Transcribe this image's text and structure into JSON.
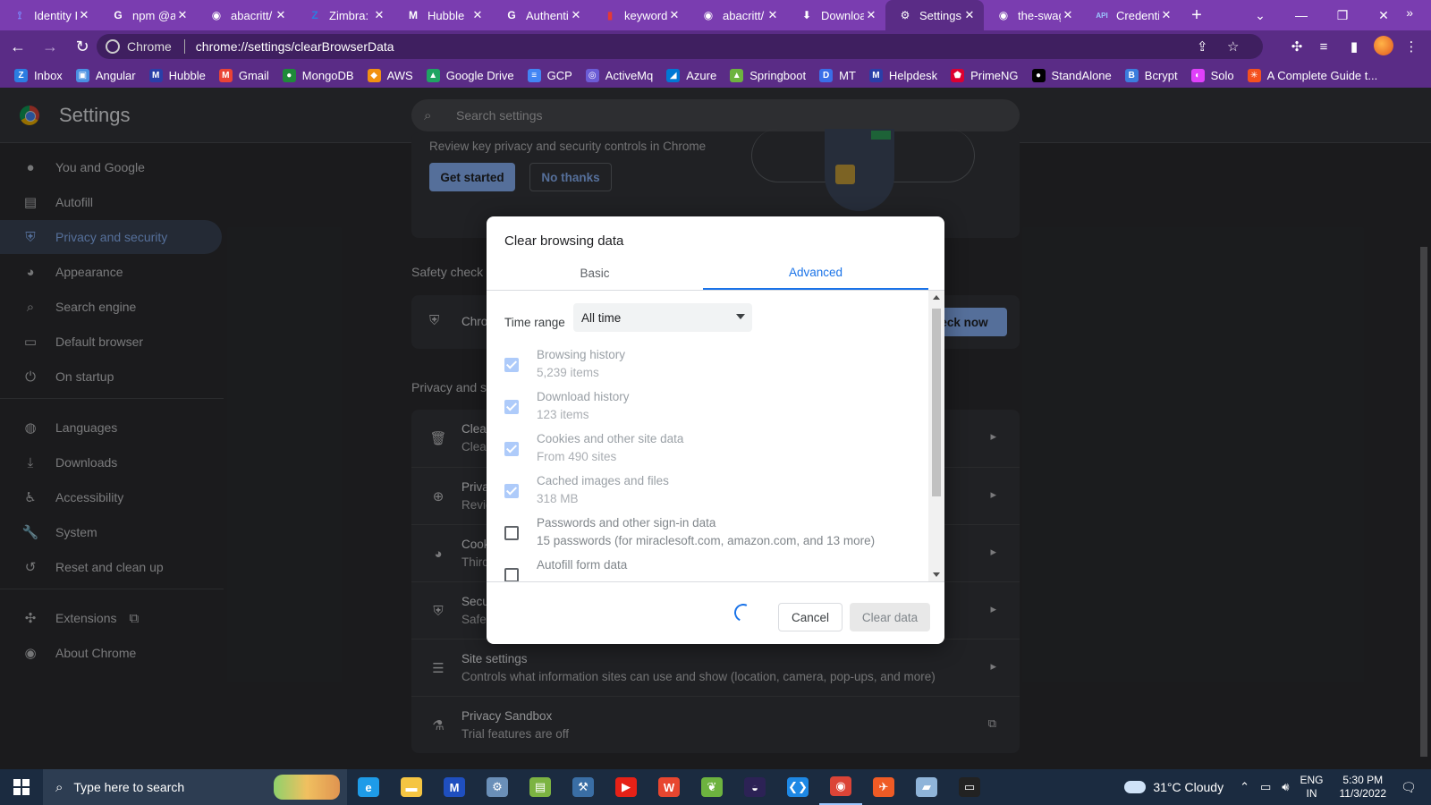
{
  "tabs": [
    {
      "label": "Identity I",
      "icon": "identity-icon",
      "color": "#7b8cff"
    },
    {
      "label": "npm @a",
      "icon": "google-icon",
      "color": "#ffffff"
    },
    {
      "label": "abacritt/",
      "icon": "github-icon",
      "color": "#ffffff"
    },
    {
      "label": "Zimbra: I",
      "icon": "zimbra-icon",
      "color": "#2b7de1"
    },
    {
      "label": "Hubble",
      "icon": "hubble-icon",
      "color": "#ffffff"
    },
    {
      "label": "Authenti",
      "icon": "google-icon",
      "color": "#ffffff"
    },
    {
      "label": "keyword",
      "icon": "keyword-icon",
      "color": "#e53935"
    },
    {
      "label": "abacritt/",
      "icon": "github-icon",
      "color": "#ffffff"
    },
    {
      "label": "Downloa",
      "icon": "download-icon",
      "color": "#ffffff"
    },
    {
      "label": "Settings",
      "icon": "gear-icon",
      "color": "#ffffff",
      "active": true
    },
    {
      "label": "the-swag",
      "icon": "github-icon",
      "color": "#ffffff"
    },
    {
      "label": "Credenti",
      "icon": "api-icon",
      "color": "#9cc7ff"
    }
  ],
  "tab_icon_glyphs": {
    "identity-icon": "⟟",
    "google-icon": "G",
    "github-icon": "◉",
    "zimbra-icon": "Z",
    "hubble-icon": "M",
    "keyword-icon": "▮",
    "download-icon": "⬇",
    "gear-icon": "⚙",
    "api-icon": "API"
  },
  "omnibox": {
    "chip": "Chrome",
    "url": "chrome://settings/clearBrowserData"
  },
  "bookmarks": [
    {
      "label": "Inbox",
      "glyph": "Z",
      "color": "#2b7de1"
    },
    {
      "label": "Angular",
      "glyph": "▣",
      "color": "#4a90e2"
    },
    {
      "label": "Hubble",
      "glyph": "M",
      "color": "#2a3fa8"
    },
    {
      "label": "Gmail",
      "glyph": "M",
      "color": "#ea4335"
    },
    {
      "label": "MongoDB",
      "glyph": "●",
      "color": "#1f8a3a"
    },
    {
      "label": "AWS",
      "glyph": "◆",
      "color": "#f29111"
    },
    {
      "label": "Google Drive",
      "glyph": "▲",
      "color": "#1fa463"
    },
    {
      "label": "GCP",
      "glyph": "≡",
      "color": "#4285f4"
    },
    {
      "label": "ActiveMq",
      "glyph": "◎",
      "color": "#6b5cd6"
    },
    {
      "label": "Azure",
      "glyph": "◢",
      "color": "#0078d4"
    },
    {
      "label": "Springboot",
      "glyph": "▲",
      "color": "#6db33f"
    },
    {
      "label": "MT",
      "glyph": "D",
      "color": "#3a6ee8"
    },
    {
      "label": "Helpdesk",
      "glyph": "M",
      "color": "#2a3fa8"
    },
    {
      "label": "PrimeNG",
      "glyph": "⬟",
      "color": "#dd0031"
    },
    {
      "label": "StandAlone",
      "glyph": "●",
      "color": "#000000"
    },
    {
      "label": "Bcrypt",
      "glyph": "B",
      "color": "#3b7ddd"
    },
    {
      "label": "Solo",
      "glyph": "◐",
      "color": "#e040fb"
    },
    {
      "label": "A Complete Guide t...",
      "glyph": "✳",
      "color": "#f4511e"
    }
  ],
  "settings": {
    "title": "Settings",
    "search_placeholder": "Search settings"
  },
  "nav": [
    {
      "label": "You and Google",
      "icon": "person-icon",
      "glyph": "●"
    },
    {
      "label": "Autofill",
      "icon": "clipboard-icon",
      "glyph": "▤"
    },
    {
      "label": "Privacy and security",
      "icon": "shield-icon",
      "glyph": "⛨",
      "active": true
    },
    {
      "label": "Appearance",
      "icon": "palette-icon",
      "glyph": "◕"
    },
    {
      "label": "Search engine",
      "icon": "search-icon",
      "glyph": "⌕"
    },
    {
      "label": "Default browser",
      "icon": "browser-icon",
      "glyph": "▭"
    },
    {
      "label": "On startup",
      "icon": "power-icon",
      "glyph": "⏻"
    },
    {
      "label": "Languages",
      "icon": "globe-icon",
      "glyph": "◍"
    },
    {
      "label": "Downloads",
      "icon": "download-icon",
      "glyph": "⤓"
    },
    {
      "label": "Accessibility",
      "icon": "accessibility-icon",
      "glyph": "♿"
    },
    {
      "label": "System",
      "icon": "wrench-icon",
      "glyph": "🔧"
    },
    {
      "label": "Reset and clean up",
      "icon": "history-icon",
      "glyph": "↺"
    },
    {
      "label": "Extensions",
      "icon": "puzzle-icon",
      "glyph": "✣"
    },
    {
      "label": "About Chrome",
      "icon": "chrome-icon",
      "glyph": "◉"
    }
  ],
  "main": {
    "guide_text": "Review key privacy and security controls in Chrome",
    "get_started": "Get started",
    "no_thanks": "No thanks",
    "safety_check_title": "Safety check",
    "safety_row_title": "Chro",
    "check_now": "eck now",
    "privacy_section_title": "Privacy and s",
    "rows": [
      {
        "title": "Clear",
        "sub": "Clear",
        "icon": "trash-icon",
        "glyph": "🗑"
      },
      {
        "title": "Priva",
        "sub": "Revie",
        "icon": "privacy-guide-icon",
        "glyph": "⊕"
      },
      {
        "title": "Cook",
        "sub": "Third",
        "icon": "cookie-icon",
        "glyph": "◕"
      },
      {
        "title": "Secu",
        "sub": "Safe",
        "icon": "shield-icon",
        "glyph": "⛨"
      },
      {
        "title": "Site settings",
        "sub": "Controls what information sites can use and show (location, camera, pop-ups, and more)",
        "icon": "sliders-icon",
        "glyph": "☰"
      },
      {
        "title": "Privacy Sandbox",
        "sub": "Trial features are off",
        "icon": "flask-icon",
        "glyph": "⚗",
        "external": true
      }
    ]
  },
  "dialog": {
    "title": "Clear browsing data",
    "tab_basic": "Basic",
    "tab_advanced": "Advanced",
    "time_range_label": "Time range",
    "time_range_value": "All time",
    "options": [
      {
        "title": "Browsing history",
        "sub": "5,239 items",
        "checked": true
      },
      {
        "title": "Download history",
        "sub": "123 items",
        "checked": true
      },
      {
        "title": "Cookies and other site data",
        "sub": "From 490 sites",
        "checked": true
      },
      {
        "title": "Cached images and files",
        "sub": "318 MB",
        "checked": true
      },
      {
        "title": "Passwords and other sign-in data",
        "sub": "15 passwords (for miraclesoft.com, amazon.com, and 13 more)",
        "checked": false
      },
      {
        "title": "Autofill form data",
        "sub": "",
        "checked": false
      }
    ],
    "cancel": "Cancel",
    "clear": "Clear data"
  },
  "taskbar": {
    "search_placeholder": "Type here to search",
    "weather": "31°C  Cloudy",
    "lang_line1": "ENG",
    "lang_line2": "IN",
    "time": "5:30 PM",
    "date": "11/3/2022",
    "apps": [
      {
        "name": "edge-icon",
        "glyph": "e",
        "color": "#1e9be8"
      },
      {
        "name": "file-explorer-icon",
        "glyph": "▬",
        "color": "#f5c542"
      },
      {
        "name": "hubble-app-icon",
        "glyph": "M",
        "color": "#1f4fbf"
      },
      {
        "name": "network-icon",
        "glyph": "⚙",
        "color": "#6a8fb8"
      },
      {
        "name": "notepad-icon",
        "glyph": "▤",
        "color": "#7cb342"
      },
      {
        "name": "ssms-icon",
        "glyph": "⚒",
        "color": "#3a6ea5"
      },
      {
        "name": "youtube-icon",
        "glyph": "▶",
        "color": "#e62117"
      },
      {
        "name": "wps-icon",
        "glyph": "W",
        "color": "#e8462f"
      },
      {
        "name": "spring-icon",
        "glyph": "❦",
        "color": "#6db33f"
      },
      {
        "name": "eclipse-icon",
        "glyph": "◒",
        "color": "#2c2255"
      },
      {
        "name": "vscode-icon",
        "glyph": "❮❯",
        "color": "#1e88e5"
      },
      {
        "name": "chrome-taskbar-icon",
        "glyph": "◉",
        "color": "#db4437",
        "active": true
      },
      {
        "name": "postman-icon",
        "glyph": "✈",
        "color": "#ef5b25"
      },
      {
        "name": "notes-icon",
        "glyph": "▰",
        "color": "#8fb4d9"
      },
      {
        "name": "terminal-icon",
        "glyph": "▭",
        "color": "#222222"
      }
    ]
  }
}
